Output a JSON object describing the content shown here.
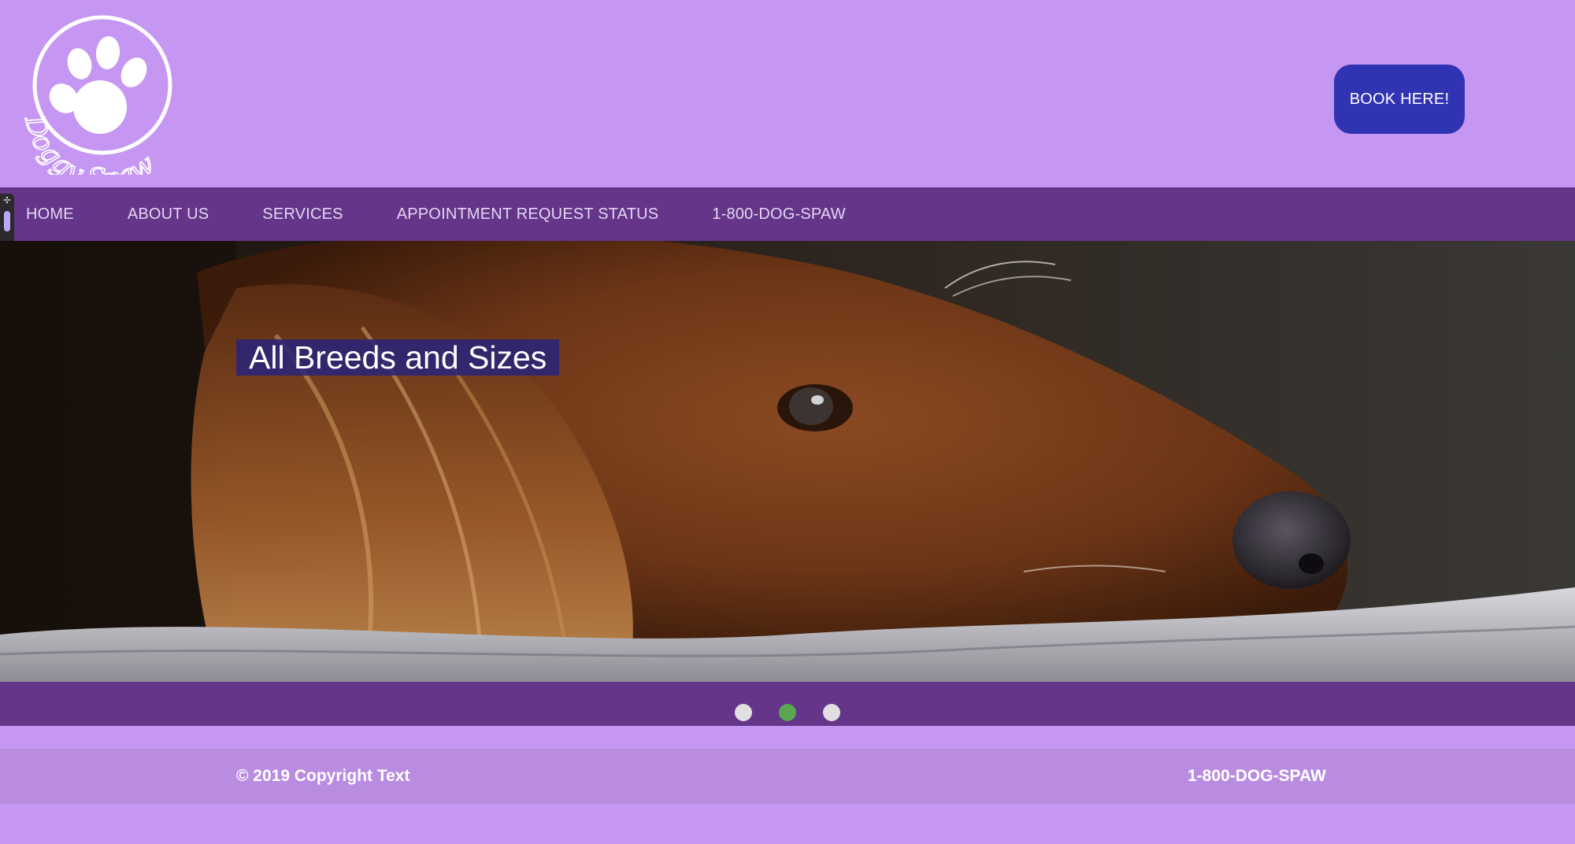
{
  "brand": {
    "logo_text": "Doggy Spaw"
  },
  "header": {
    "book_label": "BOOK HERE!"
  },
  "nav": {
    "items": [
      {
        "label": "HOME"
      },
      {
        "label": "ABOUT US"
      },
      {
        "label": "SERVICES"
      },
      {
        "label": "APPOINTMENT REQUEST STATUS"
      },
      {
        "label": "1-800-DOG-SPAW"
      }
    ]
  },
  "hero": {
    "caption": "All Breeds and Sizes",
    "image_icon": "dog-photo"
  },
  "carousel": {
    "slide_count": 3,
    "active_index": 1,
    "active_color": "#5aa652",
    "inactive_color": "#e2dfe3"
  },
  "footer": {
    "copyright": "© 2019 Copyright Text",
    "phone": "1-800-DOG-SPAW"
  },
  "colors": {
    "header_bg": "#c597f2",
    "nav_bg": "#643588",
    "button_bg": "#3134b2",
    "footer_bg": "#b98ce2"
  }
}
